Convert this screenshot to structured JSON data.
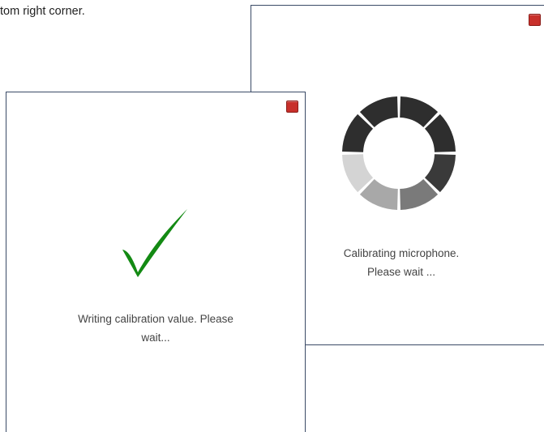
{
  "caption": "tom right corner.",
  "calibrating_dialog": {
    "message_line1": "Calibrating microphone.",
    "message_line2": "Please wait ...",
    "close_color": "#c8302b",
    "spinner_icon": "loading-spinner-icon"
  },
  "writing_dialog": {
    "message_line1": "Writing calibration value. Please",
    "message_line2": "wait...",
    "close_color": "#c8302b",
    "check_icon": "checkmark-icon",
    "check_color": "#138a13"
  }
}
